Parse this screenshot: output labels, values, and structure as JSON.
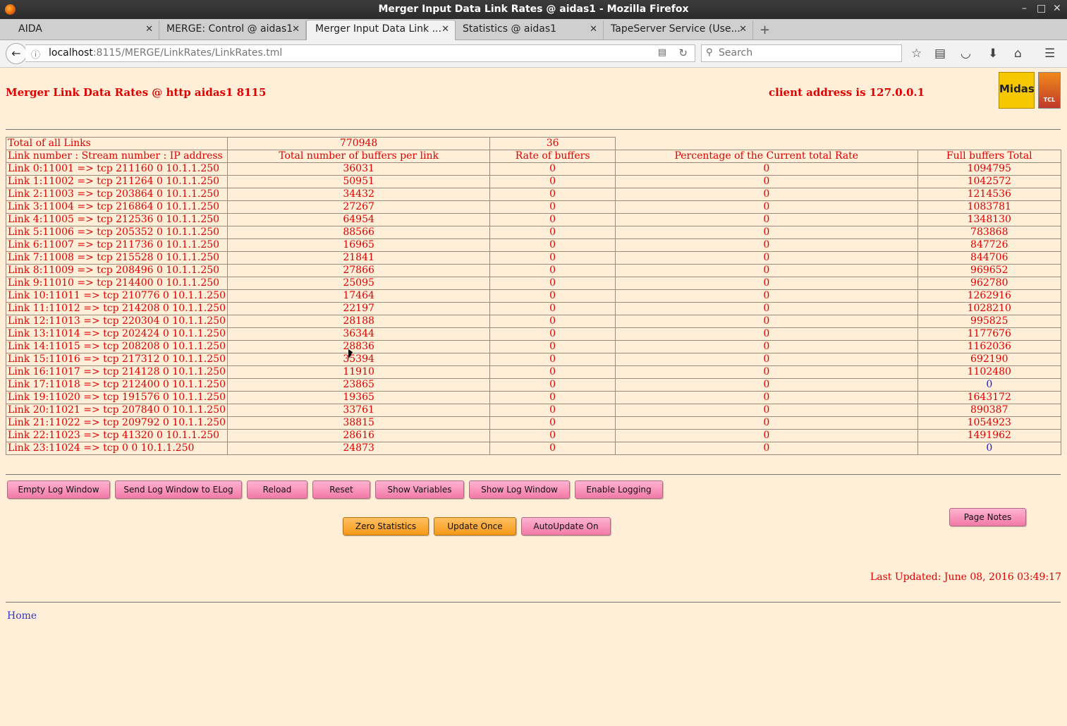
{
  "window": {
    "title": "Merger Input Data Link Rates @ aidas1 - Mozilla Firefox",
    "min": "–",
    "max": "□",
    "close": "✕"
  },
  "tabs": [
    {
      "label": "AIDA"
    },
    {
      "label": "MERGE: Control @ aidas1"
    },
    {
      "label": "Merger Input Data Link ..."
    },
    {
      "label": "Statistics @ aidas1"
    },
    {
      "label": "TapeServer Service (Use..."
    }
  ],
  "nav": {
    "url_host": "localhost",
    "url_rest": ":8115/MERGE/LinkRates/LinkRates.tml",
    "search_placeholder": "Search"
  },
  "page": {
    "title": "Merger Link Data Rates @ http aidas1 8115",
    "client": "client address is 127.0.0.1",
    "logo_midas": "Midas",
    "logo_tcl": "TCL"
  },
  "table": {
    "total": {
      "label": "Total of all Links",
      "buffers": "770948",
      "rate": "36"
    },
    "headers": [
      "Link number : Stream number : IP address",
      "Total number of buffers per link",
      "Rate of buffers",
      "Percentage of the Current total Rate",
      "Full buffers Total"
    ],
    "rows": [
      [
        "Link 0:11001 => tcp 211160 0 10.1.1.250",
        "36031",
        "0",
        "0",
        "1094795"
      ],
      [
        "Link 1:11002 => tcp 211264 0 10.1.1.250",
        "50951",
        "0",
        "0",
        "1042572"
      ],
      [
        "Link 2:11003 => tcp 203864 0 10.1.1.250",
        "34432",
        "0",
        "0",
        "1214536"
      ],
      [
        "Link 3:11004 => tcp 216864 0 10.1.1.250",
        "27267",
        "0",
        "0",
        "1083781"
      ],
      [
        "Link 4:11005 => tcp 212536 0 10.1.1.250",
        "64954",
        "0",
        "0",
        "1348130"
      ],
      [
        "Link 5:11006 => tcp 205352 0 10.1.1.250",
        "88566",
        "0",
        "0",
        "783868"
      ],
      [
        "Link 6:11007 => tcp 211736 0 10.1.1.250",
        "16965",
        "0",
        "0",
        "847726"
      ],
      [
        "Link 7:11008 => tcp 215528 0 10.1.1.250",
        "21841",
        "0",
        "0",
        "844706"
      ],
      [
        "Link 8:11009 => tcp 208496 0 10.1.1.250",
        "27866",
        "0",
        "0",
        "969652"
      ],
      [
        "Link 9:11010 => tcp 214400 0 10.1.1.250",
        "25095",
        "0",
        "0",
        "962780"
      ],
      [
        "Link 10:11011 => tcp 210776 0 10.1.1.250",
        "17464",
        "0",
        "0",
        "1262916"
      ],
      [
        "Link 11:11012 => tcp 214208 0 10.1.1.250",
        "22197",
        "0",
        "0",
        "1028210"
      ],
      [
        "Link 12:11013 => tcp 220304 0 10.1.1.250",
        "28188",
        "0",
        "0",
        "995825"
      ],
      [
        "Link 13:11014 => tcp 202424 0 10.1.1.250",
        "36344",
        "0",
        "0",
        "1177676"
      ],
      [
        "Link 14:11015 => tcp 208208 0 10.1.1.250",
        "28836",
        "0",
        "0",
        "1162036"
      ],
      [
        "Link 15:11016 => tcp 217312 0 10.1.1.250",
        "35394",
        "0",
        "0",
        "692190"
      ],
      [
        "Link 16:11017 => tcp 214128 0 10.1.1.250",
        "11910",
        "0",
        "0",
        "1102480"
      ],
      [
        "Link 17:11018 => tcp 212400 0 10.1.1.250",
        "23865",
        "0",
        "0",
        "0"
      ],
      [
        "Link 19:11020 => tcp 191576 0 10.1.1.250",
        "19365",
        "0",
        "0",
        "1643172"
      ],
      [
        "Link 20:11021 => tcp 207840 0 10.1.1.250",
        "33761",
        "0",
        "0",
        "890387"
      ],
      [
        "Link 21:11022 => tcp 209792 0 10.1.1.250",
        "38815",
        "0",
        "0",
        "1054923"
      ],
      [
        "Link 22:11023 => tcp 41320 0 10.1.1.250",
        "28616",
        "0",
        "0",
        "1491962"
      ],
      [
        "Link 23:11024 => tcp 0 0 10.1.1.250",
        "24873",
        "0",
        "0",
        "0"
      ]
    ]
  },
  "buttons": {
    "empty_log": "Empty Log Window",
    "send_log": "Send Log Window to ELog",
    "reload": "Reload",
    "reset": "Reset",
    "show_vars": "Show Variables",
    "show_log": "Show Log Window",
    "enable_logging": "Enable Logging",
    "zero_stats": "Zero Statistics",
    "update_once": "Update Once",
    "autoupdate": "AutoUpdate On",
    "page_notes": "Page Notes"
  },
  "footer": {
    "last_updated": "Last Updated: June 08, 2016 03:49:17",
    "home": "Home"
  },
  "colors": {
    "page_bg": "#ffefd8",
    "text_red": "#e00000",
    "zero_blue": "#1a1ad0",
    "button_pink": "#f27aa6",
    "button_orange": "#f59a18"
  }
}
